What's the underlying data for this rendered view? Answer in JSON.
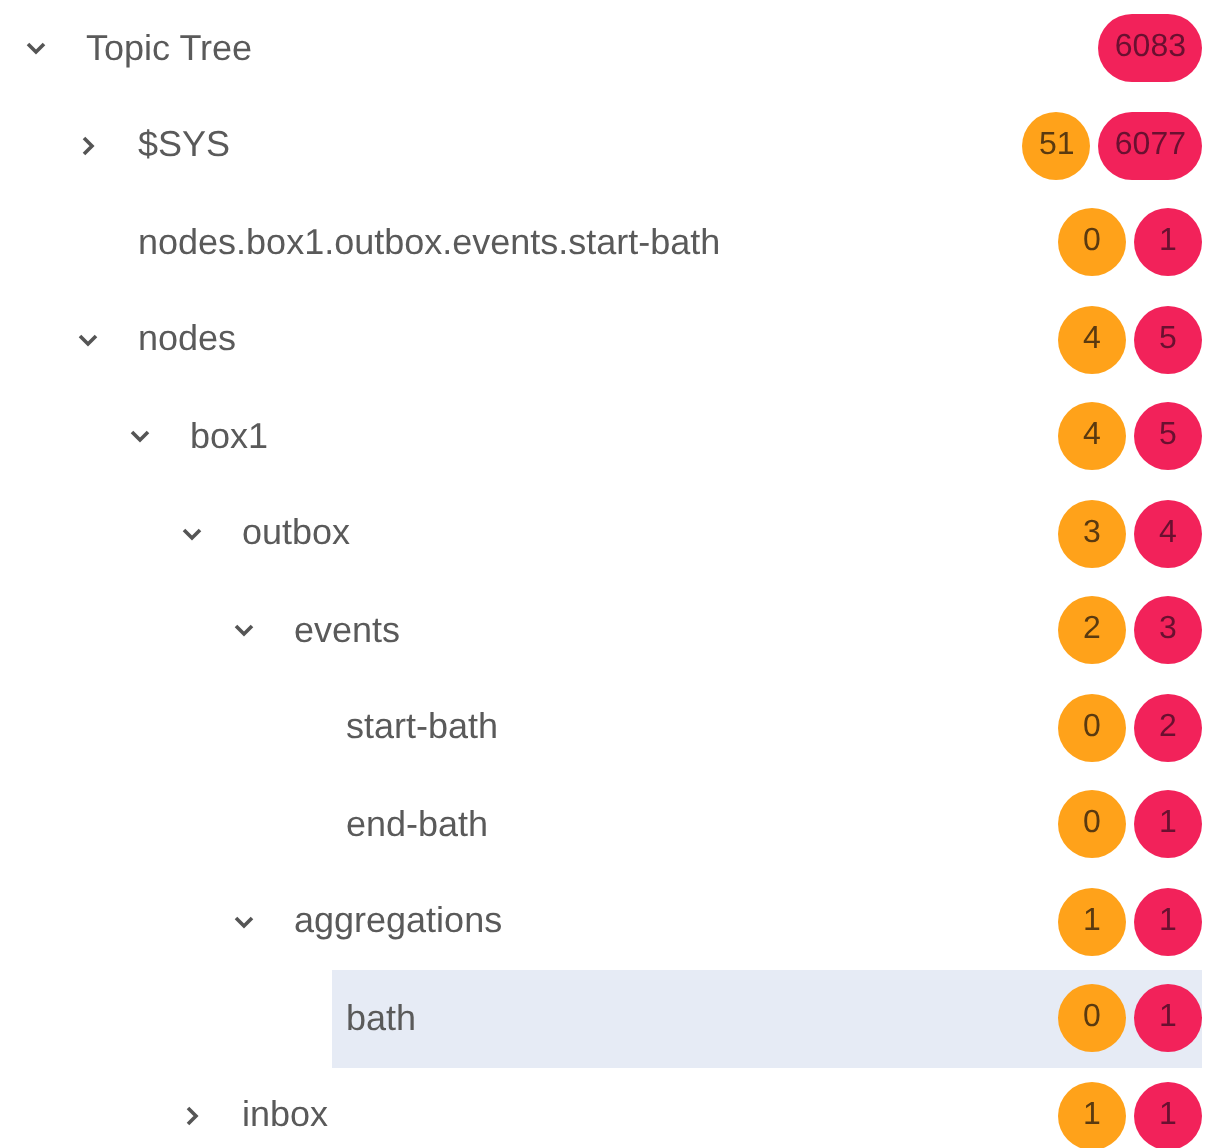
{
  "tree": {
    "label": "Topic Tree",
    "expanded": true,
    "selected": false,
    "messages": "6083",
    "children": [
      {
        "label": "$SYS",
        "expanded": false,
        "selected": false,
        "topics": "51",
        "messages": "6077"
      },
      {
        "label": "nodes.box1.outbox.events.start-bath",
        "selected": false,
        "topics": "0",
        "messages": "1"
      },
      {
        "label": "nodes",
        "expanded": true,
        "selected": false,
        "topics": "4",
        "messages": "5",
        "children": [
          {
            "label": "box1",
            "expanded": true,
            "selected": false,
            "topics": "4",
            "messages": "5",
            "children": [
              {
                "label": "outbox",
                "expanded": true,
                "selected": false,
                "topics": "3",
                "messages": "4",
                "children": [
                  {
                    "label": "events",
                    "expanded": true,
                    "selected": false,
                    "topics": "2",
                    "messages": "3",
                    "children": [
                      {
                        "label": "start-bath",
                        "selected": false,
                        "topics": "0",
                        "messages": "2"
                      },
                      {
                        "label": "end-bath",
                        "selected": false,
                        "topics": "0",
                        "messages": "1"
                      }
                    ]
                  },
                  {
                    "label": "aggregations",
                    "expanded": true,
                    "selected": false,
                    "topics": "1",
                    "messages": "1",
                    "children": [
                      {
                        "label": "bath",
                        "selected": true,
                        "topics": "0",
                        "messages": "1"
                      }
                    ]
                  }
                ]
              },
              {
                "label": "inbox",
                "expanded": false,
                "selected": false,
                "topics": "1",
                "messages": "1"
              }
            ]
          }
        ]
      }
    ]
  }
}
